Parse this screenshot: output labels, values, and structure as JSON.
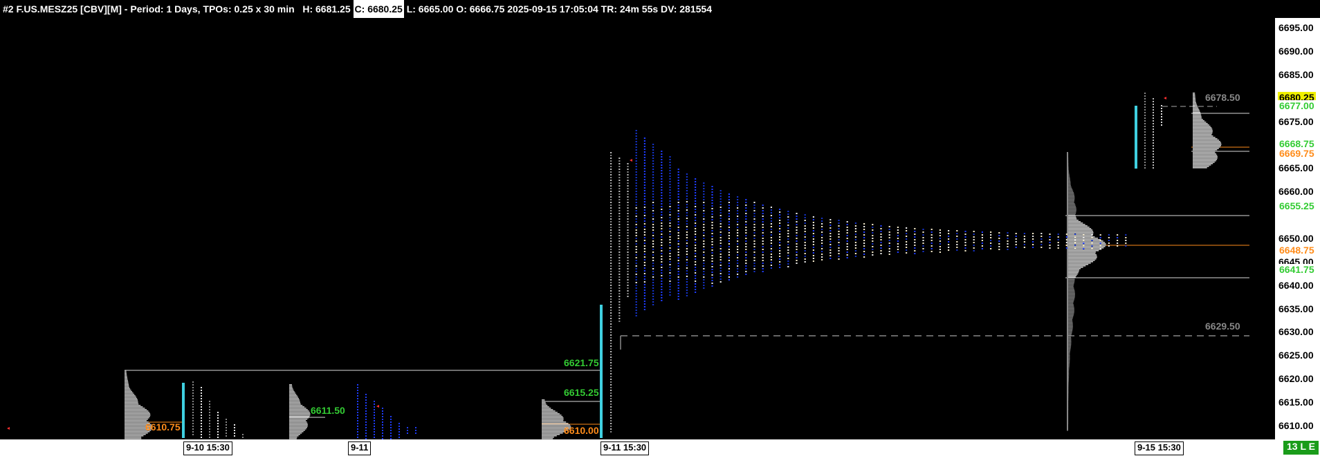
{
  "header": {
    "symbol_info": "#2 F.US.MESZ25 [CBV][M] - Period: 1 Days, TPOs: 0.25 x 30 min",
    "high": "H: 6681.25",
    "close": "C: 6680.25",
    "rest": "L: 6665.00 O: 6666.75 2025-09-15 17:05:04 TR: 24m 55s DV: 281554"
  },
  "price_axis": {
    "ticks": [
      "6695.00",
      "6690.00",
      "6685.00",
      "6680.00",
      "6675.00",
      "6665.00",
      "6660.00",
      "6650.00",
      "6645.00",
      "6640.00",
      "6635.00",
      "6630.00",
      "6625.00",
      "6620.00",
      "6615.00",
      "6610.00"
    ],
    "highlight_values": [
      {
        "text": "6680.25",
        "color": "#ffff66",
        "bg": "#e6e600"
      },
      {
        "text": "6677.00",
        "color": "#33cc33"
      },
      {
        "text": "6668.75",
        "color": "#33cc33"
      },
      {
        "text": "6669.75",
        "color": "#ff8c1a"
      },
      {
        "text": "6655.25",
        "color": "#33cc33"
      },
      {
        "text": "6648.75",
        "color": "#ff8c1a"
      },
      {
        "text": "6641.75",
        "color": "#33cc33"
      }
    ]
  },
  "date_axis": {
    "labels": [
      "9-10  15:30",
      "9-11",
      "9-11  15:30",
      "9-15  15:30"
    ]
  },
  "chart_levels": [
    {
      "text": "6610.75",
      "color": "#ff8c1a"
    },
    {
      "text": "6611.50",
      "color": "#33cc33"
    },
    {
      "text": "6621.75",
      "color": "#33cc33"
    },
    {
      "text": "6615.25",
      "color": "#33cc33"
    },
    {
      "text": "6610.00",
      "color": "#ff8c1a"
    },
    {
      "text": "6629.50",
      "color": "#888888"
    },
    {
      "text": "6678.50",
      "color": "#888888"
    }
  ],
  "status": {
    "indicator": "13 L E"
  },
  "colors": {
    "tpo_blue": "#1e3cff",
    "tpo_white": "#e8e8e8",
    "tpo_gray": "#888888",
    "initial_balance": "#3fd0e0",
    "poc": "#ff8c1a",
    "profile": "#bfbfbf"
  },
  "chart_data": {
    "type": "other",
    "price_range": [
      6607,
      6698
    ],
    "sessions": [
      {
        "date": "9-10  15:30",
        "poc": 6610.75,
        "profile_range": [
          6607,
          6621.75
        ],
        "ib_range": [
          6607,
          6620
        ]
      },
      {
        "date": "9-11",
        "value_level": 6611.5,
        "profile_range": [
          6607,
          6620
        ]
      },
      {
        "date": "9-11",
        "levels": [
          6621.75,
          6615.25,
          6610.0
        ],
        "profile_range": [
          6607,
          6616
        ]
      },
      {
        "date": "9-11  15:30",
        "poc": 6648.75,
        "vah": 6655.25,
        "val": 6641.75,
        "range": [
          6610,
          6668
        ],
        "profile_range": [
          6609,
          6668
        ]
      },
      {
        "date": "9-15  15:30",
        "poc": 6669.75,
        "vah": 6677.0,
        "val": 6668.75,
        "range": [
          6665,
          6681.25
        ],
        "last": 6680.25
      }
    ],
    "reference_levels": [
      6629.5,
      6678.5
    ]
  }
}
